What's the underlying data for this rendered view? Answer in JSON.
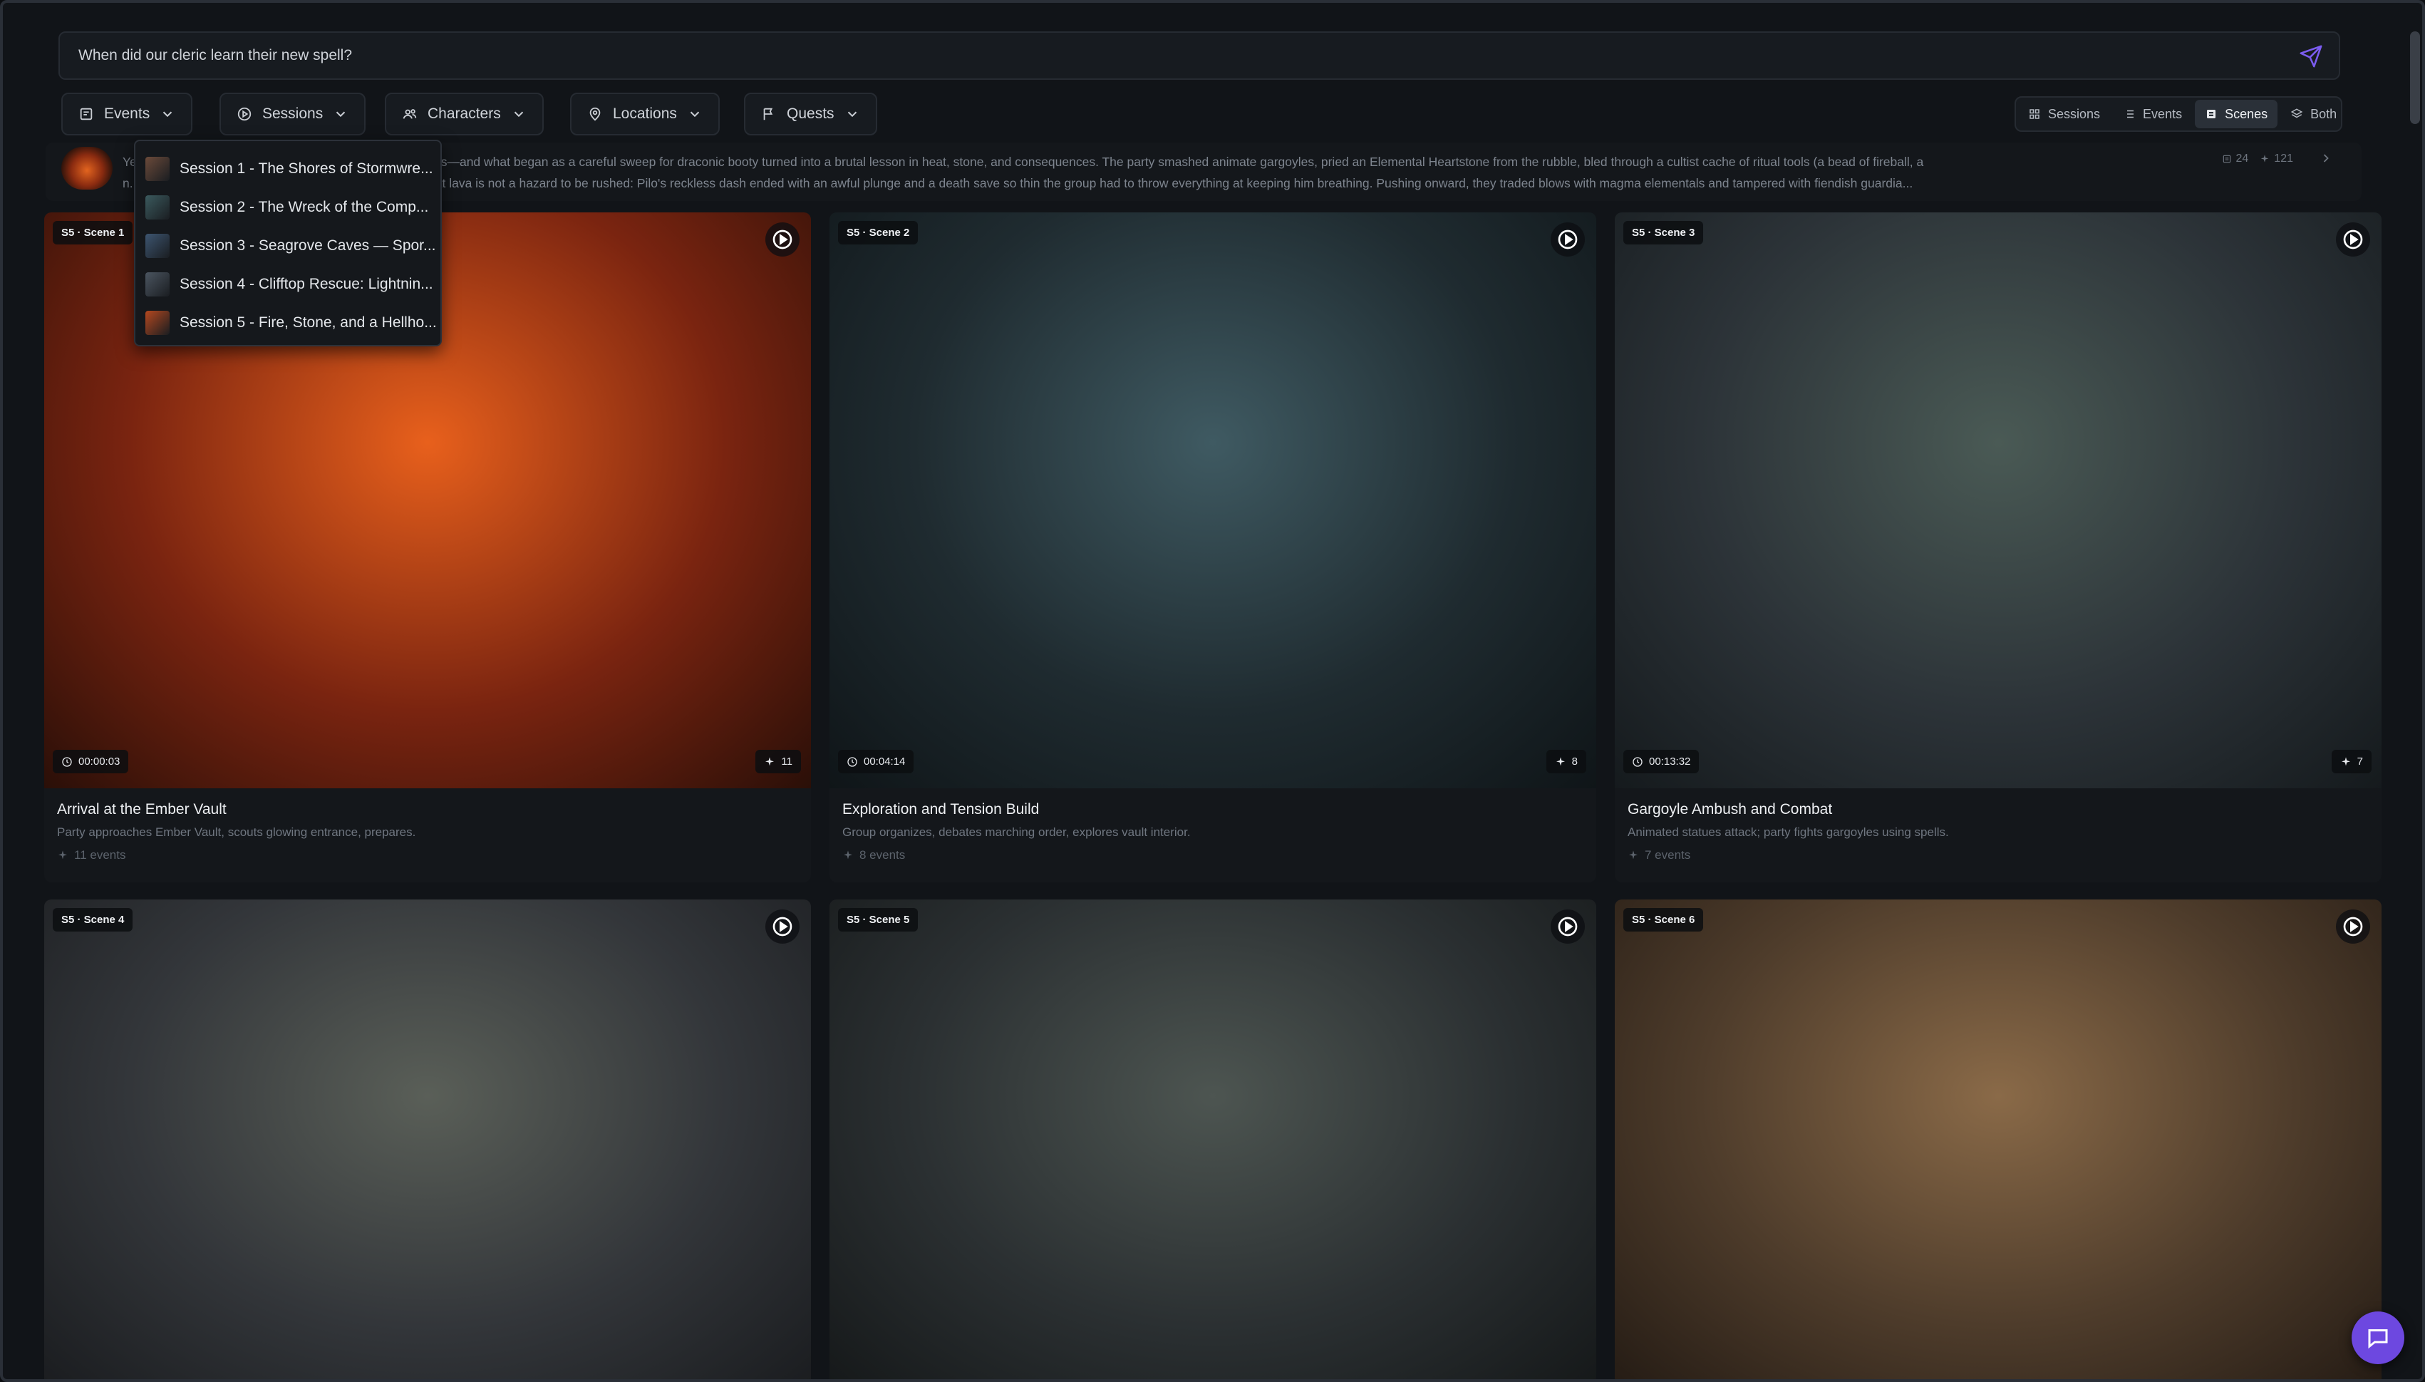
{
  "search": {
    "value": "When did our cleric learn their new spell?",
    "placeholder": ""
  },
  "filters": [
    {
      "label": "Events",
      "icon": "calendar-icon"
    },
    {
      "label": "Sessions",
      "icon": "play-circle-icon"
    },
    {
      "label": "Characters",
      "icon": "users-icon"
    },
    {
      "label": "Locations",
      "icon": "map-pin-icon"
    },
    {
      "label": "Quests",
      "icon": "flag-icon"
    }
  ],
  "view_toggle": [
    {
      "label": "Sessions",
      "icon": "grid-icon",
      "active": false
    },
    {
      "label": "Events",
      "icon": "list-icon",
      "active": false
    },
    {
      "label": "Scenes",
      "icon": "film-icon",
      "active": true
    },
    {
      "label": "Both",
      "icon": "layers-icon",
      "active": false
    }
  ],
  "summary": {
    "text_line1": "Ye... island's old malice and the echo of Runara's warnings—and what began as a careful sweep for draconic booty turned into a brutal lesson in heat, stone, and consequences. The party smashed animate gargoyles, pried an Elemental Heartstone from the rubble, bled through a cultist cache of ritual tools (a bead of fireball, a",
    "text_line2": "n... and an ashen veil) and then learned, to their price, that lava is not a hazard to be rushed: Pilo's reckless dash ended with an awful plunge and a death save so thin the group had to throw everything at keeping him breathing. Pushing onward, they traded blows with magma elementals and tampered with fiendish guardia...",
    "scenes_count": "24",
    "events_count": "121"
  },
  "sessions_dropdown": [
    {
      "label": "Session 1 - The Shores of Stormwre...",
      "thumb_color": "#6b4a3a"
    },
    {
      "label": "Session 2 - The Wreck of the Comp...",
      "thumb_color": "#3b5a5e"
    },
    {
      "label": "Session 3 - Seagrove Caves — Spor...",
      "thumb_color": "#3d5570"
    },
    {
      "label": "Session 4 - Clifftop Rescue: Lightnin...",
      "thumb_color": "#4b5560"
    },
    {
      "label": "Session 5 - Fire, Stone, and a Hellho...",
      "thumb_color": "#b4481f"
    }
  ],
  "scenes": [
    {
      "badge": "S5 · Scene 1",
      "time": "00:00:03",
      "count": "11",
      "title": "Arrival at the Ember Vault",
      "desc": "Party approaches Ember Vault, scouts glowing entrance, prepares.",
      "events": "11 events",
      "palette": [
        "#e8601c",
        "#7a2410",
        "#2a0f08"
      ]
    },
    {
      "badge": "S5 · Scene 2",
      "time": "00:04:14",
      "count": "8",
      "title": "Exploration and Tension Build",
      "desc": "Group organizes, debates marching order, explores vault interior.",
      "events": "8 events",
      "palette": [
        "#3f5a62",
        "#1f2b30",
        "#0f1518"
      ]
    },
    {
      "badge": "S5 · Scene 3",
      "time": "00:13:32",
      "count": "7",
      "title": "Gargoyle Ambush and Combat",
      "desc": "Animated statues attack; party fights gargoyles using spells.",
      "events": "7 events",
      "palette": [
        "#4a5a55",
        "#2c3338",
        "#151a1d"
      ]
    },
    {
      "badge": "S5 · Scene 4",
      "palette": [
        "#5a5f58",
        "#33363a",
        "#1a1c1f"
      ]
    },
    {
      "badge": "S5 · Scene 5",
      "palette": [
        "#4d5551",
        "#2b3032",
        "#151819"
      ]
    },
    {
      "badge": "S5 · Scene 6",
      "palette": [
        "#8a6a48",
        "#4e3c2b",
        "#241b14"
      ]
    }
  ]
}
